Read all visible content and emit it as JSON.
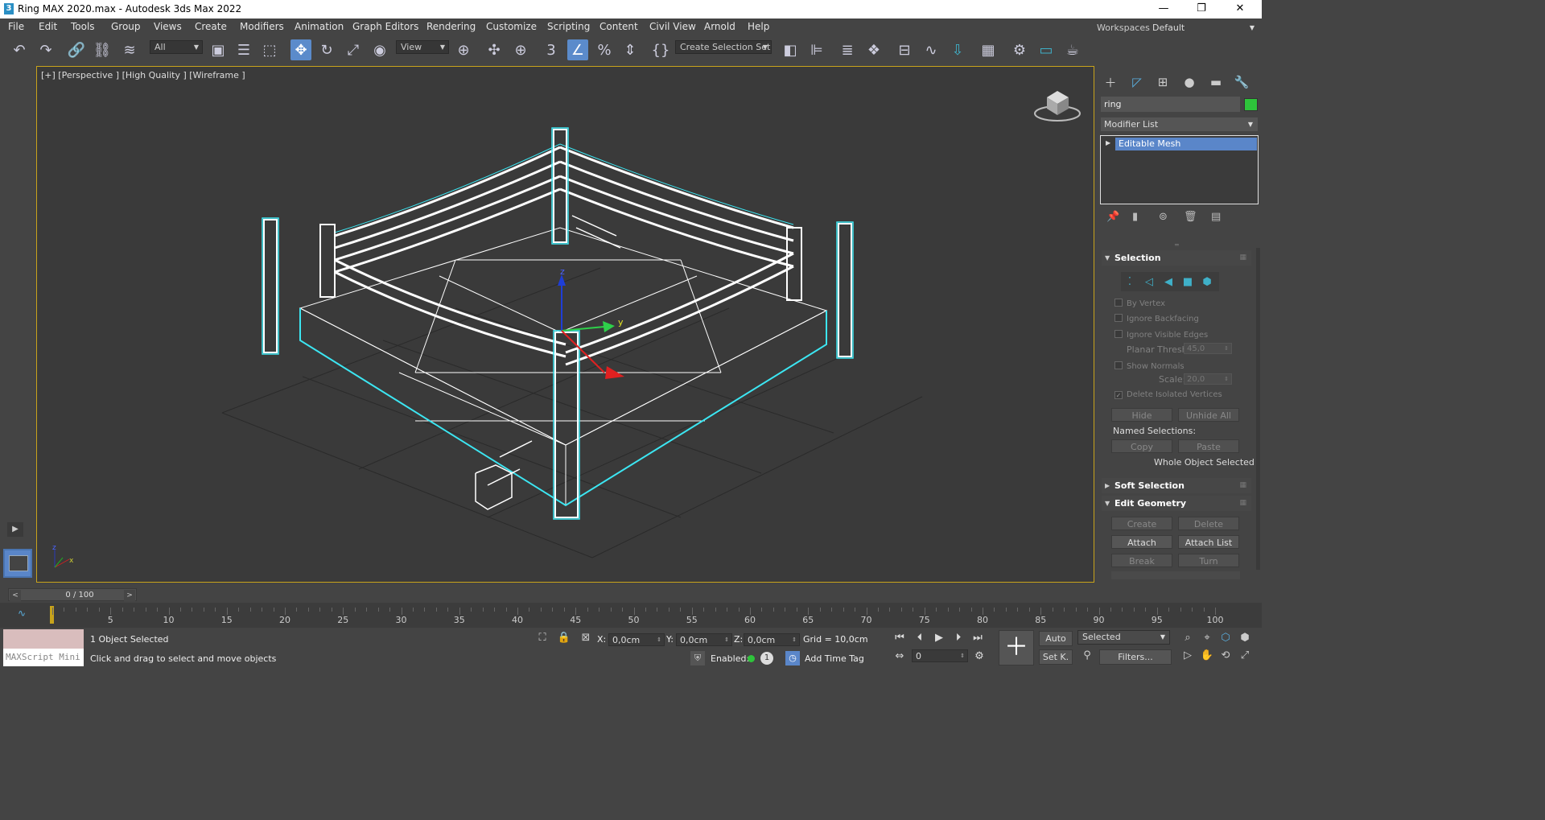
{
  "window": {
    "title": "Ring MAX 2020.max - Autodesk 3ds Max 2022",
    "app_icon": "3",
    "minimize": "—",
    "restore": "❐",
    "close": "✕"
  },
  "menu": [
    "File",
    "Edit",
    "Tools",
    "Group",
    "Views",
    "Create",
    "Modifiers",
    "Animation",
    "Graph Editors",
    "Rendering",
    "Customize",
    "Scripting",
    "Content",
    "Civil View",
    "Arnold",
    "Help"
  ],
  "workspaces": {
    "label": "Workspaces:",
    "value": "Default"
  },
  "toolbar": {
    "filter_value": "All",
    "coord_system": "View",
    "selection_set": "Create Selection Set",
    "icons": {
      "undo": "↶",
      "redo": "↷",
      "link": "🔗",
      "unlink": "⛓",
      "bind": "≋",
      "select": "▣",
      "select_by_name": "☰",
      "rect_region": "⬚",
      "move": "✥",
      "rotate": "↻",
      "scale": "⤢",
      "place": "◉",
      "pivot": "⊕",
      "move_transform": "✣",
      "snap": "3",
      "angle_snap": "∠",
      "percent_snap": "%",
      "spinner_snap": "⇕",
      "edit_named": "{}",
      "mirror": "◧",
      "align": "⊫",
      "layer_explorer": "≣",
      "layers": "❖",
      "curve_editor": "∿",
      "schematic": "⊟",
      "dope": "⇩",
      "material": "▦",
      "render_setup": "⚙",
      "rendered_frame": "▭",
      "render": "☕"
    }
  },
  "viewport": {
    "label": "[+] [Perspective ] [High Quality ] [Wireframe ]",
    "gizmo_axes": {
      "x": "x",
      "y": "y",
      "z": "z"
    },
    "colors": {
      "wire": "#ffffff",
      "selection": "#3ce6f2",
      "grid": "#2a2a2a",
      "border": "#c8a31b"
    }
  },
  "command_panel": {
    "object_name": "ring",
    "object_color": "#2ec43b",
    "modifier_list": "Modifier List",
    "stack_item": "Editable Mesh",
    "selection": {
      "title": "Selection",
      "by_vertex": "By Vertex",
      "ignore_backfacing": "Ignore Backfacing",
      "ignore_visible_edges": "Ignore Visible Edges",
      "planar_thresh_label": "Planar Thresh:",
      "planar_thresh": "45,0",
      "show_normals": "Show Normals",
      "scale_label": "Scale:",
      "scale": "20,0",
      "delete_isolated": "Delete Isolated Vertices",
      "delete_isolated_checked": "✓",
      "hide": "Hide",
      "unhide_all": "Unhide All",
      "named_selections": "Named Selections:",
      "copy": "Copy",
      "paste": "Paste",
      "status": "Whole Object Selected"
    },
    "soft_selection": {
      "title": "Soft Selection"
    },
    "edit_geometry": {
      "title": "Edit Geometry",
      "create": "Create",
      "delete": "Delete",
      "attach": "Attach",
      "attach_list": "Attach List",
      "break": "Break",
      "turn": "Turn"
    }
  },
  "time_slider": {
    "label": "0 / 100",
    "prev": "<",
    "next": ">"
  },
  "trackbar": {
    "ticks": [
      "5",
      "10",
      "15",
      "20",
      "25",
      "30",
      "35",
      "40",
      "45",
      "50",
      "55",
      "60",
      "65",
      "70",
      "75",
      "80",
      "85",
      "90",
      "95",
      "100"
    ]
  },
  "status": {
    "maxscript": "MAXScript Mini",
    "selected": "1 Object Selected",
    "prompt": "Click and drag to select and move objects",
    "x_label": "X:",
    "x": "0,0cm",
    "y_label": "Y:",
    "y": "0,0cm",
    "z_label": "Z:",
    "z": "0,0cm",
    "grid": "Grid = 10,0cm",
    "enabled": "Enabled:",
    "add_time_tag": "Add Time Tag",
    "auto": "Auto",
    "set_key": "Set K.",
    "key_filter": "Selected",
    "filters": "Filters...",
    "frame": "0"
  }
}
